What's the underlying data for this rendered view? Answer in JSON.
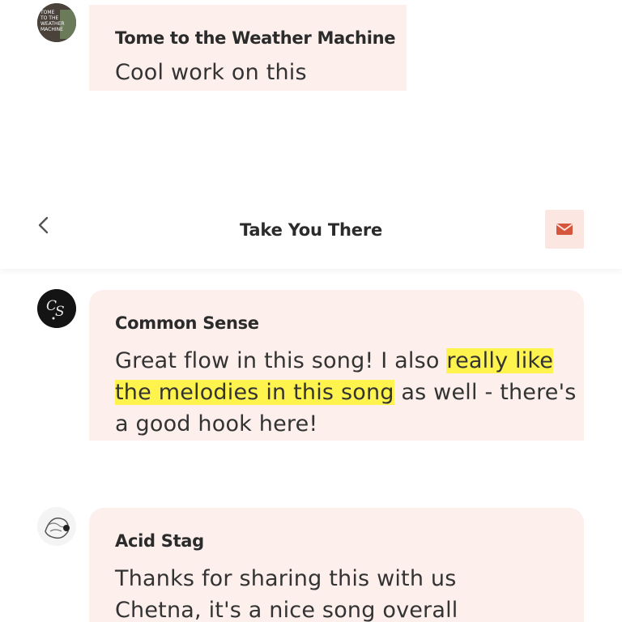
{
  "comments": [
    {
      "author": "Tome to the Weather Machine",
      "text": "Cool work on this",
      "avatar_icon": "tome-to-the-weather-machine-avatar",
      "avatar_lettering": "TOME TO THE WEATHER MACHINE"
    },
    {
      "author": "Common Sense",
      "text_before": "Great flow in this song! I also ",
      "text_highlight": "really like the melodies in this song",
      "text_after": " as well - there's a good hook here!",
      "avatar_icon": "common-sense-avatar",
      "avatar_lettering": "CS",
      "highlight_color": "#fff34d"
    },
    {
      "author": "Acid Stag",
      "text": "Thanks for sharing this with us Chetna, it's a nice song overall",
      "avatar_icon": "acid-stag-avatar"
    }
  ],
  "header": {
    "title": "Take You There",
    "back_icon": "chevron-left-icon",
    "mail_icon": "envelope-icon"
  },
  "colors": {
    "bubble_bg": "#fcefec",
    "accent": "#d6563d",
    "mail_button_bg": "#fce6e2"
  }
}
